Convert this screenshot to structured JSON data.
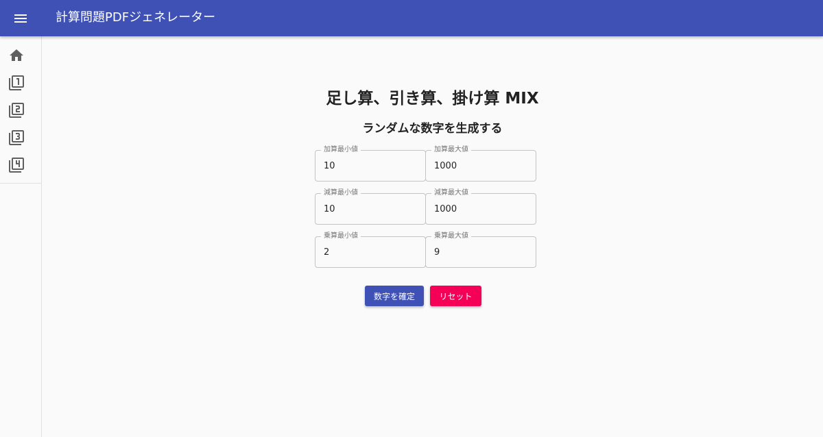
{
  "appbar": {
    "title": "計算問題PDFジェネレーター"
  },
  "drawer": {
    "items": [
      {
        "icon": "home-icon"
      },
      {
        "icon": "filter-1-icon"
      },
      {
        "icon": "filter-2-icon"
      },
      {
        "icon": "filter-3-icon"
      },
      {
        "icon": "filter-4-icon"
      }
    ]
  },
  "main": {
    "title": "足し算、引き算、掛け算 MIX",
    "subtitle": "ランダムな数字を生成する",
    "fields": {
      "add_min": {
        "label": "加算最小値",
        "value": "10"
      },
      "add_max": {
        "label": "加算最大値",
        "value": "1000"
      },
      "sub_min": {
        "label": "減算最小値",
        "value": "10"
      },
      "sub_max": {
        "label": "減算最大値",
        "value": "1000"
      },
      "mul_min": {
        "label": "乗算最小値",
        "value": "2"
      },
      "mul_max": {
        "label": "乗算最大値",
        "value": "9"
      }
    },
    "buttons": {
      "confirm": "数字を確定",
      "reset": "リセット"
    }
  },
  "colors": {
    "primary": "#3f51b5",
    "secondary": "#f50057",
    "background": "#fafafa"
  }
}
